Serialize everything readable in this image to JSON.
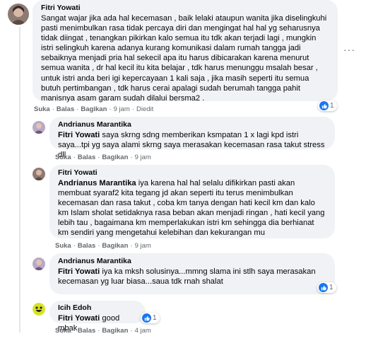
{
  "comments": [
    {
      "author": "Fitri Yowati",
      "mention": "",
      "text": "Sangat wajar jika ada hal kecemasan , baik lelaki ataupun wanita jika diselingkuhi pasti menimbulkan rasa tidak percaya diri dan mengingat hal hal yg seharusnya tidak diingat , tenangkan pikirkan kalo semua itu tdk akan terjadi lagi , mungkin istri selingkuh karena adanya kurang komunikasi dalam rumah tangga jadi sebaiknya menjadi pria hal sekecil apa itu harus dibicarakan karena menurut semua wanita , dr hal kecil itu kita belajar , tdk harus menunggu msalah besar , untuk istri anda beri igi kepercayaan 1 kali saja , jika masih seperti itu semua butuh pertimbangan , tdk harus cerai apalagi sudah berumah tangga pahit manisnya asam garam sudah dilalui bersma2 .",
      "like": "Suka",
      "reply": "Balas",
      "share": "Bagikan",
      "time": "9 jam",
      "edited": "Diedit",
      "reactions": "1"
    },
    {
      "author": "Andrianus Marantika",
      "mention": "Fitri Yowati",
      "text": " saya skrng sdng memberikan ksmpatan 1 x lagi kpd istri saya...tpi yg saya alami skrng saya merasakan kecemasan rasa takut stress dll",
      "like": "Suka",
      "reply": "Balas",
      "share": "Bagikan",
      "time": "9 jam"
    },
    {
      "author": "Fitri Yowati",
      "mention": "Andrianus Marantika",
      "text": " iya karena hal hal selalu difikirkan pasti akan membuat syaraf2 kita tegang jd akan seperti itu terus menimbulkan kecemasan dan rasa takut , coba km tanya dengan hati kecil km dan kalo km Islam sholat setidaknya rasa beban akan menjadi ringan , hati kecil yang lebih tau , bagaimana km memperlakukan istri km sehingga dia berhianat km sendiri yang mengetahui kelebihan dan kekurangan mu",
      "like": "Suka",
      "reply": "Balas",
      "share": "Bagikan",
      "time": "9 jam"
    },
    {
      "author": "Andrianus Marantika",
      "mention": "Fitri Yowati",
      "text": " iya ka mksh solusinya...mmng slama ini stlh saya merasakan kecemasan yg luar biasa...saua tdk rnah shalat",
      "like": "Suka",
      "reply": "Balas",
      "share": "Bagikan",
      "time": "9 jam",
      "reactions": "1"
    },
    {
      "author": "Icih Edoh",
      "mention": "Fitri Yowati",
      "text": " good mbak",
      "like": "Suka",
      "reply": "Balas",
      "share": "Bagikan",
      "time": "4 jam",
      "reactions": "1"
    }
  ],
  "colors": {
    "bubble": "#f0f2f5",
    "like_blue": "#1877f2",
    "meta": "#65676b"
  },
  "icons": {
    "like": "thumbs-up-icon",
    "more": "more-options-icon"
  }
}
